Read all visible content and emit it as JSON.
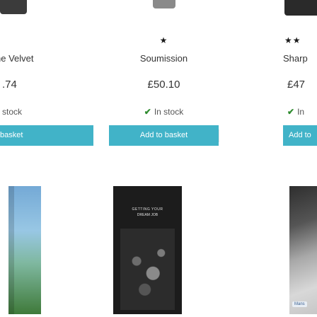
{
  "products": [
    {
      "id": "left",
      "rating": "",
      "name": "ne Velvet",
      "price": ".74",
      "stock_icon": "check-icon",
      "stock": "stock",
      "button_label": "basket"
    },
    {
      "id": "mid",
      "rating": "★",
      "name": "Soumission",
      "price": "£50.10",
      "stock_icon": "check-icon",
      "stock": "In stock",
      "button_label": "Add to basket"
    },
    {
      "id": "right",
      "rating": "★★",
      "name": "Sharp",
      "price": "£47",
      "stock_icon": "check-icon",
      "stock": "In",
      "button_label": "Add to"
    }
  ],
  "covers": {
    "mid_line1": "GETTING YOUR",
    "mid_line2": "DREAM JOB",
    "right_label": "Mans"
  },
  "colors": {
    "button_bg": "#41b3c8",
    "button_text": "#ffffff",
    "stock_check": "#2e8b2e"
  }
}
